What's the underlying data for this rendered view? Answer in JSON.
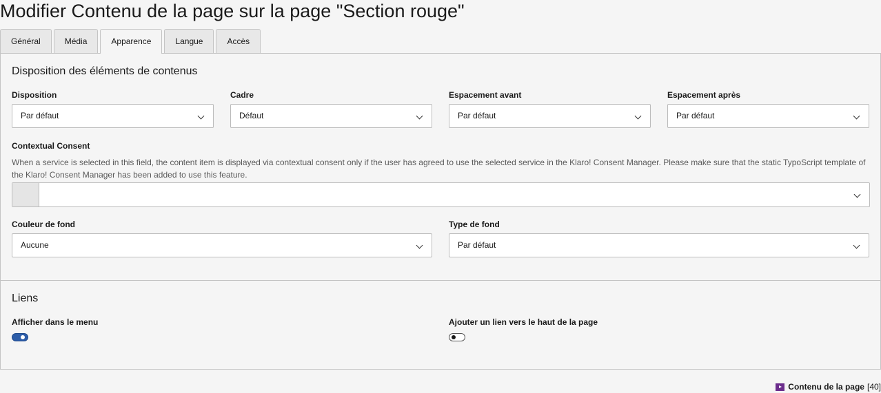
{
  "page_title": "Modifier Contenu de la page sur la page \"Section rouge\"",
  "tabs": [
    {
      "label": "Général",
      "active": false
    },
    {
      "label": "Média",
      "active": false
    },
    {
      "label": "Apparence",
      "active": true
    },
    {
      "label": "Langue",
      "active": false
    },
    {
      "label": "Accès",
      "active": false
    }
  ],
  "layout_section": {
    "title": "Disposition des éléments de contenus",
    "disposition": {
      "label": "Disposition",
      "value": "Par défaut"
    },
    "cadre": {
      "label": "Cadre",
      "value": "Défaut"
    },
    "space_before": {
      "label": "Espacement avant",
      "value": "Par défaut"
    },
    "space_after": {
      "label": "Espacement après",
      "value": "Par défaut"
    },
    "consent": {
      "label": "Contextual Consent",
      "help": "When a service is selected in this field, the content item is displayed via contextual consent only if the user has agreed to use the selected service in the Klaro! Consent Manager. Please make sure that the static TypoScript template of the Klaro! Consent Manager has been added to use this feature.",
      "value": ""
    },
    "bg_color": {
      "label": "Couleur de fond",
      "value": "Aucune"
    },
    "bg_type": {
      "label": "Type de fond",
      "value": "Par défaut"
    }
  },
  "links_section": {
    "title": "Liens",
    "show_in_menu": {
      "label": "Afficher dans le menu",
      "checked": true
    },
    "top_link": {
      "label": "Ajouter un lien vers le haut de la page",
      "checked": false
    }
  },
  "footer": {
    "icon": "content-element-icon",
    "label": "Contenu de la page",
    "id": "[40]"
  },
  "colors": {
    "toggle_on": "#2d5da8",
    "content_icon": "#6b2d8c"
  }
}
